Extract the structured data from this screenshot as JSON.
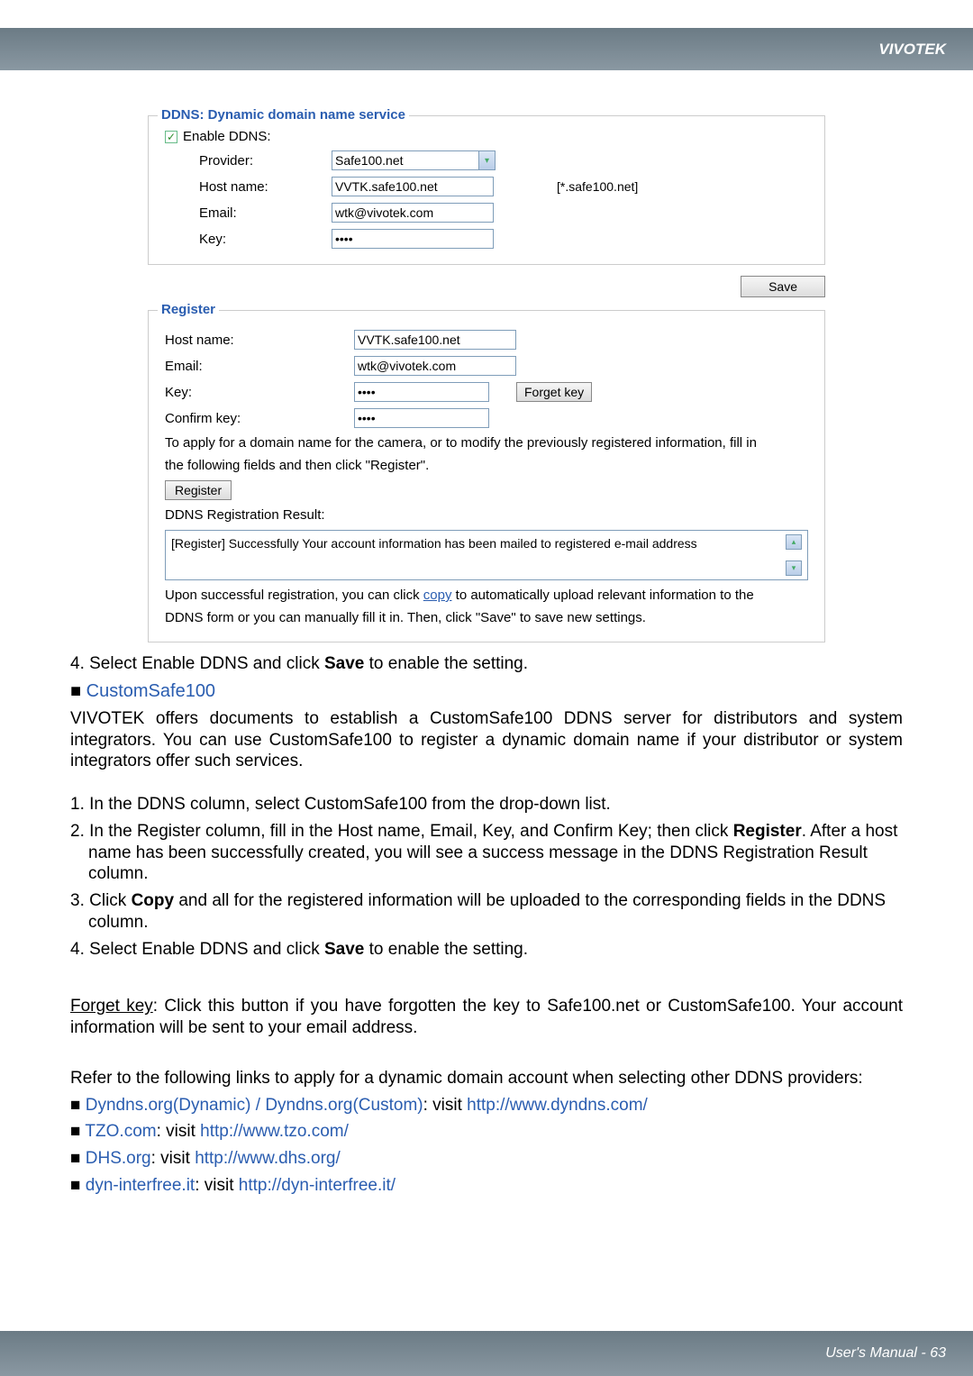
{
  "header": {
    "brand": "VIVOTEK"
  },
  "ddns": {
    "title": "DDNS: Dynamic domain name service",
    "enable": "Enable DDNS:",
    "provider_label": "Provider:",
    "provider_value": "Safe100.net",
    "host_label": "Host name:",
    "host_value": "VVTK.safe100.net",
    "host_hint": "[*.safe100.net]",
    "email_label": "Email:",
    "email_value": "wtk@vivotek.com",
    "key_label": "Key:",
    "key_value": "••••",
    "save": "Save"
  },
  "register": {
    "title": "Register",
    "host_label": "Host name:",
    "host_value": "VVTK.safe100.net",
    "email_label": "Email:",
    "email_value": "wtk@vivotek.com",
    "key_label": "Key:",
    "key_value": "••••",
    "forget": "Forget key",
    "confirm_label": "Confirm key:",
    "confirm_value": "••••",
    "help1": "To apply for a domain name for the camera, or to modify the previously registered information, fill in",
    "help2": "the following fields and then click \"Register\".",
    "register_btn": "Register",
    "result_label": "DDNS Registration Result:",
    "result_text": "[Register] Successfully Your account information has been mailed to registered e-mail address",
    "post1a": "Upon successful registration, you can click ",
    "post1b": "copy",
    "post1c": " to automatically upload relevant information to the",
    "post2": "DDNS form or you can manually fill it in. Then, click \"Save\" to save new settings."
  },
  "body": {
    "step4": "4. Select Enable DDNS and click ",
    "save_bold": "Save",
    "step4b": " to enable the setting.",
    "cs_title": "CustomSafe100",
    "cs_para": "VIVOTEK offers documents to establish a CustomSafe100 DDNS server for distributors and system integrators. You can use CustomSafe100 to register a dynamic domain name if your distributor or system integrators offer such services.",
    "s1": "1. In the DDNS column, select CustomSafe100 from the drop-down list.",
    "s2a": "2. In the Register column, fill in the Host name, Email, Key, and Confirm Key; then click ",
    "s2b": "Register",
    "s2c": ". After a host name has been successfully created, you will see a success message in the DDNS Registration Result column.",
    "s3a": "3. Click ",
    "s3b": "Copy",
    "s3c": " and all for the registered information will be uploaded to the corresponding fields in the DDNS column.",
    "s4a": "4. Select Enable DDNS and click ",
    "s4b": "Save",
    "s4c": " to enable the setting.",
    "forget_label": "Forget key",
    "forget_text": ": Click this button if you have forgotten the key to Safe100.net or CustomSafe100. Your account information will be sent to your email address.",
    "links_intro": "Refer to the following links to apply for a dynamic domain account when selecting other DDNS providers:",
    "l1a": "Dyndns.org(Dynamic) / Dyndns.org(Custom)",
    "l1b": ": visit ",
    "l1c": "http://www.dyndns.com/",
    "l2a": "TZO.com",
    "l2b": ": visit ",
    "l2c": "http://www.tzo.com/",
    "l3a": "DHS.org",
    "l3b": ": visit ",
    "l3c": "http://www.dhs.org/",
    "l4a": "dyn-interfree.it",
    "l4b": ": visit ",
    "l4c": "http://dyn-interfree.it/"
  },
  "footer": {
    "text": "User's Manual - 63"
  }
}
